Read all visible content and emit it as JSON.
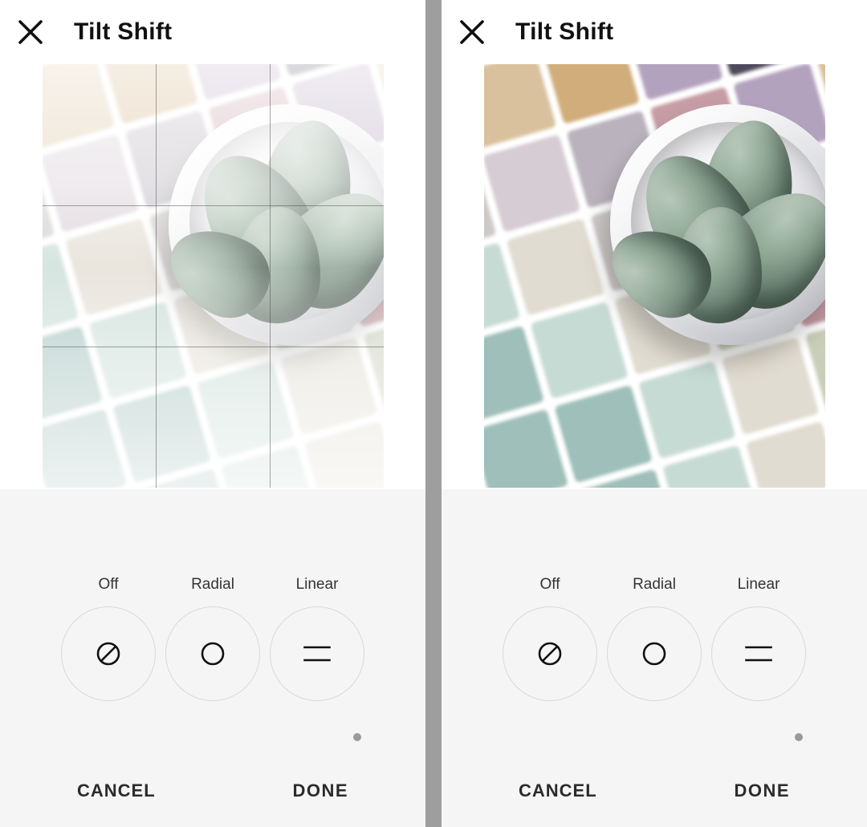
{
  "panels": [
    {
      "id": "left",
      "title": "Tilt Shift",
      "show_grid_overlay": true,
      "show_white_veil": true,
      "options": {
        "off": "Off",
        "radial": "Radial",
        "linear": "Linear"
      },
      "selected_option": "linear",
      "footer": {
        "cancel": "CANCEL",
        "done": "DONE"
      }
    },
    {
      "id": "right",
      "title": "Tilt Shift",
      "show_grid_overlay": false,
      "show_white_veil": false,
      "options": {
        "off": "Off",
        "radial": "Radial",
        "linear": "Linear"
      },
      "selected_option": "linear",
      "footer": {
        "cancel": "CANCEL",
        "done": "DONE"
      }
    }
  ],
  "icons": {
    "close": "close-icon",
    "off": "null-slash-icon",
    "radial": "circle-icon",
    "linear": "two-lines-icon",
    "page_dot": "page-indicator-dot"
  }
}
